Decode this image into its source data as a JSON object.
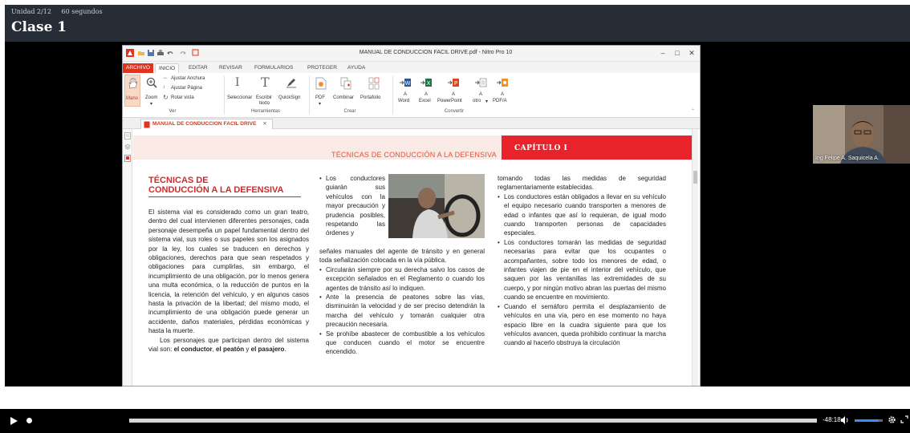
{
  "header": {
    "unit": "Unidad 2/12",
    "duration": "60 segundos",
    "title": "Clase 1"
  },
  "nitro": {
    "window_title": "MANUAL DE CONDUCCION FACIL DRIVE.pdf - Nitro Pro 10",
    "tabs": [
      "ARCHIVO",
      "INICIO",
      "EDITAR",
      "REVISAR",
      "FORMULARIOS",
      "PROTEGER",
      "AYUDA"
    ],
    "ribbon": {
      "ver": {
        "label": "Ver",
        "mano": "Mano",
        "zoom": "Zoom",
        "ajustar_anchura": "Ajustar Anchura",
        "ajustar_pagina": "Ajustar Página",
        "rotar_vista": "Rotar vista"
      },
      "herramientas": {
        "label": "Herramientas",
        "seleccionar": "Seleccionar",
        "escribir_texto_1": "Escribir",
        "escribir_texto_2": "texto",
        "quicksign": "QuickSign"
      },
      "crear": {
        "label": "Crear",
        "pdf": "PDF",
        "combinar": "Combinar",
        "portafolio": "Portafolio"
      },
      "convertir": {
        "label": "Convertir",
        "a": "A",
        "word": "Word",
        "excel": "Excel",
        "powerpoint": "PowerPoint",
        "otro": "otro",
        "pdfa": "PDF/A"
      }
    },
    "doc_tab": "MANUAL DE CONDUCCION FACIL DRIVE",
    "page": {
      "band_subtitle": "TÉCNICAS DE CONDUCCIÓN A LA DEFENSIVA",
      "chapter": "CAPÍTULO I",
      "title_line1": "TÉCNICAS DE",
      "title_line2": "CONDUCCIÓN A LA DEFENSIVA",
      "col1_p1": "El sistema vial es considerado como un gran teatro, dentro del cual intervienen diferentes personajes, cada personaje desempeña un papel fundamental dentro del sistema vial, sus roles o sus papeles son los asignados por la ley, los cuales se traducen en derechos y obligaciones, derechos para que sean respetados y obligaciones para cumplirlas, sin embargo, el incumplimiento de una obligación, por lo menos genera una multa económica, o la reducción de puntos en la licencia, la retención del vehículo, y en algunos casos hasta la privación de la libertad; del mismo modo, el incumplimiento de una obligación puede generar un accidente, daños materiales, pérdidas económicas y hasta la muerte.",
      "col1_p2_start": "Los personajes que participan dentro del sistema vial son: ",
      "col1_p2_b1": "el conductor",
      "col1_p2_sep": ", ",
      "col1_p2_b2": "el peatón",
      "col1_p2_y": " y ",
      "col1_p2_b3": "el pasajero",
      "col1_p2_end": ".",
      "col2_b1_short": "Los conductores guiarán sus vehículos con la mayor precaución y prudencia posibles, respetando las órdenes y",
      "col2_b1_rest": "señales manuales del agente de tránsito y en general toda señalización colocada en la vía pública.",
      "col2_b2": "Circularán siempre por su derecha salvo los casos de excepción señalados en el Reglamento o cuando los agentes de tránsito así lo indiquen.",
      "col2_b3": "Ante la presencia de peatones sobre las vías, disminuirán la velocidad y de ser preciso detendrán la marcha del vehículo y tomarán cualquier otra precaución necesaria.",
      "col2_b4": "Se prohíbe abastecer de combustible a los vehículos que conducen cuando el motor se encuentre encendido.",
      "col3_p1": "tomando todas las medidas de seguridad reglamentariamente establecidas.",
      "col3_b1": "Los conductores están obligados a llevar en su vehículo el equipo necesario cuando transporten a menores de edad o infantes que así lo requieran, de igual modo cuando transporten personas de capacidades especiales.",
      "col3_b2": "Los conductores tomarán las medidas de seguridad necesarias para evitar que los ocupantes o acompañantes, sobre todo los menores de edad, o infantes viajen de pie en el interior del vehículo, que saquen por las ventanillas las extremidades de su cuerpo, y por ningún motivo abran las puertas del mismo cuando se encuentre en movimiento.",
      "col3_b3": "Cuando el semáforo permita el desplazamiento de vehículos en una vía, pero en ese momento no haya espacio libre en la cuadra siguiente para que los vehículos avancen, queda prohibido continuar la marcha cuando al hacerlo obstruya la circulación"
    }
  },
  "webcam": {
    "name": "Ing Felipe A. Saquicela A."
  },
  "controls": {
    "time": "-48:18",
    "played_fraction": 0.0,
    "buffered_start": 0.13,
    "volume": 0.85
  },
  "colors": {
    "header_bg": "#272d37",
    "nitro_red": "#e0321d",
    "chapter_red": "#e8232c",
    "title_red": "#cf2a2a",
    "band_pink": "#f9eae6"
  }
}
